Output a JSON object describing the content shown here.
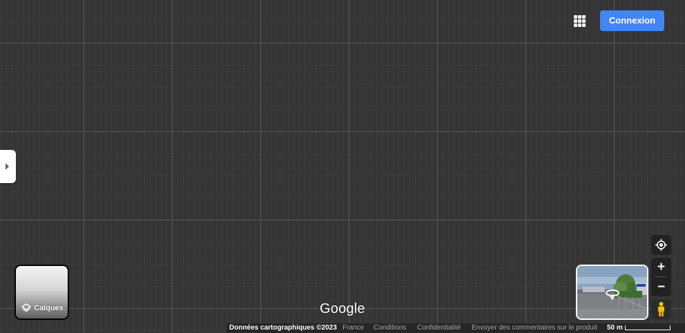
{
  "header": {
    "apps_icon": "apps-grid-icon",
    "signin_label": "Connexion",
    "signin_color": "#4285f4"
  },
  "sidebar": {
    "toggle_icon": "chevron-right-icon"
  },
  "layers": {
    "label": "Calques",
    "icon": "layers-icon"
  },
  "logo": {
    "text": "Google"
  },
  "controls": {
    "locate_icon": "my-location-icon",
    "zoom_in": "+",
    "zoom_out": "−",
    "pegman_icon": "pegman-icon",
    "street_view_icon": "street-view-rotate-icon"
  },
  "footer": {
    "map_data": "Données cartographiques ©2023",
    "region": "France",
    "terms": "Conditions",
    "privacy": "Confidentialité",
    "feedback": "Envoyer des commentaires sur le produit",
    "scale": "50 m"
  }
}
